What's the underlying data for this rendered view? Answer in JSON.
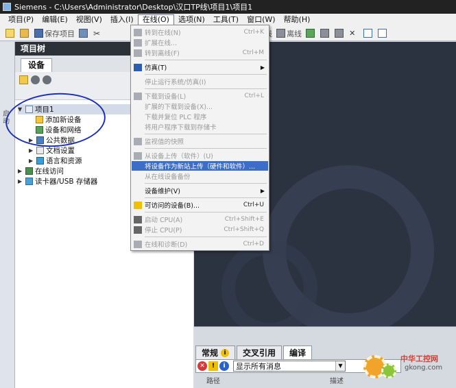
{
  "window": {
    "title": "Siemens  -  C:\\Users\\Administrator\\Desktop\\汉口TP线\\项目1\\项目1"
  },
  "menubar": {
    "items": [
      "项目(P)",
      "编辑(E)",
      "视图(V)",
      "插入(I)",
      "在线(O)",
      "选项(N)",
      "工具(T)",
      "窗口(W)",
      "帮助(H)"
    ]
  },
  "toolbar": {
    "save_label": "保存项目",
    "online_label": "在线",
    "offline_label": "离线"
  },
  "left_strip": {
    "label": "启动"
  },
  "tree": {
    "header": "项目树",
    "tab": "设备",
    "rows": [
      {
        "label": "项目1"
      },
      {
        "label": "添加新设备"
      },
      {
        "label": "设备和网络"
      },
      {
        "label": "公共数据"
      },
      {
        "label": "文档设置"
      },
      {
        "label": "语言和资源"
      },
      {
        "label": "在线访问"
      },
      {
        "label": "读卡器/USB 存储器"
      }
    ]
  },
  "online_menu": {
    "items": [
      {
        "label": "转到在线(N)",
        "shortcut": "Ctrl+K"
      },
      {
        "label": "扩展在线...",
        "shortcut": ""
      },
      {
        "label": "转到离线(F)",
        "shortcut": "Ctrl+M"
      },
      {
        "label": "仿真(T)",
        "shortcut": ""
      },
      {
        "label": "停止运行系统/仿真(I)",
        "shortcut": ""
      },
      {
        "label": "下载到设备(L)",
        "shortcut": "Ctrl+L"
      },
      {
        "label": "扩展的下载到设备(X)...",
        "shortcut": ""
      },
      {
        "label": "下载并复位 PLC 程序",
        "shortcut": ""
      },
      {
        "label": "将用户程序下载到存储卡",
        "shortcut": ""
      },
      {
        "label": "监视值的快照",
        "shortcut": ""
      },
      {
        "label": "从设备上传（软件）(U)",
        "shortcut": ""
      },
      {
        "label": "将设备作为新站上传（硬件和软件）...",
        "shortcut": ""
      },
      {
        "label": "从在线设备备份",
        "shortcut": ""
      },
      {
        "label": "设备维护(V)",
        "shortcut": ""
      },
      {
        "label": "可访问的设备(B)...",
        "shortcut": "Ctrl+U"
      },
      {
        "label": "启动 CPU(A)",
        "shortcut": "Ctrl+Shift+E"
      },
      {
        "label": "停止 CPU(P)",
        "shortcut": "Ctrl+Shift+Q"
      },
      {
        "label": "在线和诊断(D)",
        "shortcut": "Ctrl+D"
      }
    ]
  },
  "inspector": {
    "tabs": [
      "常规",
      "交叉引用",
      "编译"
    ],
    "filter_value": "显示所有消息",
    "columns": [
      "路径",
      "描述"
    ]
  },
  "watermark": {
    "text": "中华工控网",
    "url": "gkong.com"
  }
}
